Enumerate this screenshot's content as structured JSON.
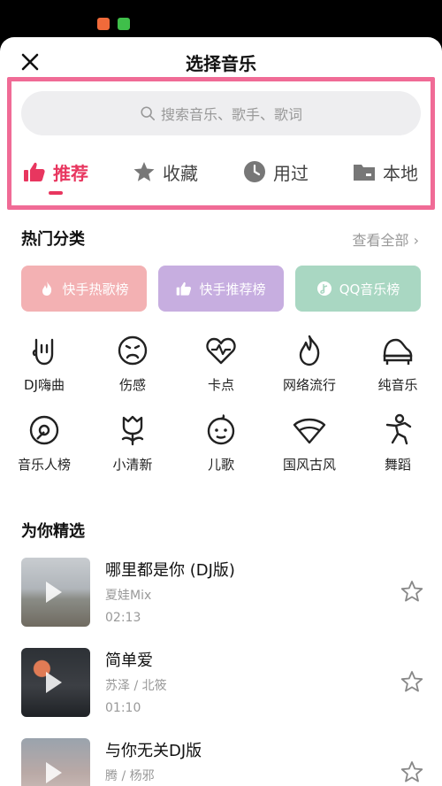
{
  "header": {
    "title": "选择音乐"
  },
  "search": {
    "placeholder": "搜索音乐、歌手、歌词"
  },
  "tabs": [
    {
      "label": "推荐",
      "icon": "thumbs-up-icon",
      "active": true
    },
    {
      "label": "收藏",
      "icon": "star-icon",
      "active": false
    },
    {
      "label": "用过",
      "icon": "clock-icon",
      "active": false
    },
    {
      "label": "本地",
      "icon": "folder-icon",
      "active": false
    }
  ],
  "hot": {
    "title": "热门分类",
    "view_all": "查看全部",
    "charts": [
      {
        "label": "快手热歌榜",
        "icon": "flame-icon",
        "color": "#f3b1b3"
      },
      {
        "label": "快手推荐榜",
        "icon": "thumbs-up-icon",
        "color": "#c7aee0"
      },
      {
        "label": "QQ音乐榜",
        "icon": "qq-music-icon",
        "color": "#a9d7c2"
      }
    ],
    "categories": [
      {
        "label": "DJ嗨曲",
        "icon": "rock-hand-icon"
      },
      {
        "label": "伤感",
        "icon": "sad-face-icon"
      },
      {
        "label": "卡点",
        "icon": "heartbeat-icon"
      },
      {
        "label": "网络流行",
        "icon": "flame-outline-icon"
      },
      {
        "label": "纯音乐",
        "icon": "piano-icon"
      },
      {
        "label": "音乐人榜",
        "icon": "vinyl-icon"
      },
      {
        "label": "小清新",
        "icon": "tulip-icon"
      },
      {
        "label": "儿歌",
        "icon": "child-face-icon"
      },
      {
        "label": "国风古风",
        "icon": "fan-icon"
      },
      {
        "label": "舞蹈",
        "icon": "dancer-icon"
      }
    ]
  },
  "picks": {
    "title": "为你精选",
    "songs": [
      {
        "title": "哪里都是你 (DJ版)",
        "artist": "夏娃Mix",
        "duration": "02:13"
      },
      {
        "title": "简单爱",
        "artist": "苏泽 / 北筱",
        "duration": "01:10"
      },
      {
        "title": "与你无关DJ版",
        "artist": "腾 / 杨邪",
        "duration": ""
      }
    ]
  },
  "colors": {
    "accent": "#e8365f",
    "highlight_border": "#f06b96"
  }
}
